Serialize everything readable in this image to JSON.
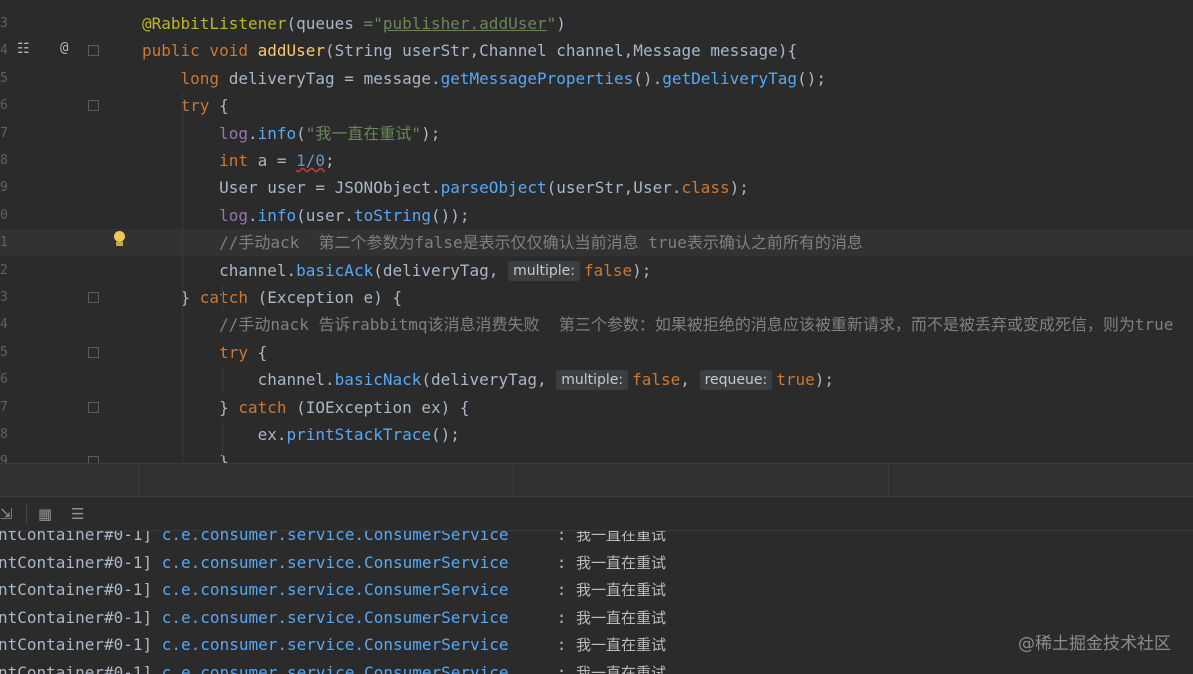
{
  "editor": {
    "line_numbers": [
      "3",
      "4",
      "5",
      "6",
      "7",
      "8",
      "9",
      "0",
      "1",
      "2",
      "3",
      "4",
      "5",
      "6",
      "7",
      "8",
      "9"
    ],
    "lines": [
      [
        {
          "t": "@RabbitListener",
          "c": "ann"
        },
        {
          "t": "(",
          "c": ""
        },
        {
          "t": "queues",
          "c": "param"
        },
        {
          "t": " =\"",
          "c": "str"
        },
        {
          "t": "publisher.addUser",
          "c": "str underline"
        },
        {
          "t": "\"",
          "c": "str"
        },
        {
          "t": ")",
          "c": ""
        }
      ],
      [
        {
          "t": "public void ",
          "c": "kw"
        },
        {
          "t": "addUser",
          "c": "fn"
        },
        {
          "t": "(String ",
          "c": ""
        },
        {
          "t": "userStr",
          "c": "param"
        },
        {
          "t": ",Channel ",
          "c": ""
        },
        {
          "t": "channel",
          "c": "param"
        },
        {
          "t": ",Message ",
          "c": ""
        },
        {
          "t": "message",
          "c": "param"
        },
        {
          "t": "){",
          "c": ""
        }
      ],
      [
        {
          "t": "    long ",
          "c": "kw"
        },
        {
          "t": "deliveryTag = ",
          "c": ""
        },
        {
          "t": "message",
          "c": "param"
        },
        {
          "t": ".",
          "c": ""
        },
        {
          "t": "getMessageProperties",
          "c": "m"
        },
        {
          "t": "().",
          "c": ""
        },
        {
          "t": "getDeliveryTag",
          "c": "m"
        },
        {
          "t": "();",
          "c": ""
        }
      ],
      [
        {
          "t": "    try ",
          "c": "kw"
        },
        {
          "t": "{",
          "c": ""
        }
      ],
      [
        {
          "t": "        log",
          "c": "fld"
        },
        {
          "t": ".",
          "c": ""
        },
        {
          "t": "info",
          "c": "m"
        },
        {
          "t": "(",
          "c": ""
        },
        {
          "t": "\"我一直在重试\"",
          "c": "str"
        },
        {
          "t": ");",
          "c": ""
        }
      ],
      [
        {
          "t": "        int ",
          "c": "kw"
        },
        {
          "t": "a = ",
          "c": ""
        },
        {
          "t": "1/0",
          "c": "num squiggle"
        },
        {
          "t": ";",
          "c": ""
        }
      ],
      [
        {
          "t": "        User user = ",
          "c": ""
        },
        {
          "t": "JSONObject",
          "c": ""
        },
        {
          "t": ".",
          "c": ""
        },
        {
          "t": "parseObject",
          "c": "m"
        },
        {
          "t": "(",
          "c": ""
        },
        {
          "t": "userStr",
          "c": "param"
        },
        {
          "t": ",User.",
          "c": ""
        },
        {
          "t": "class",
          "c": "kw"
        },
        {
          "t": ");",
          "c": ""
        }
      ],
      [
        {
          "t": "        log",
          "c": "fld"
        },
        {
          "t": ".",
          "c": ""
        },
        {
          "t": "info",
          "c": "m"
        },
        {
          "t": "(user.",
          "c": ""
        },
        {
          "t": "toString",
          "c": "m"
        },
        {
          "t": "());",
          "c": ""
        }
      ],
      [
        {
          "t": "        //手动ack  第二个参数为false是表示仅仅确认当前消息 true表示确认之前所有的消息",
          "c": "cmt"
        }
      ],
      [
        {
          "t": "        channel",
          "c": "param"
        },
        {
          "t": ".",
          "c": ""
        },
        {
          "t": "basicAck",
          "c": "m"
        },
        {
          "t": "(deliveryTag, ",
          "c": ""
        },
        {
          "t": "multiple:",
          "c": "hint"
        },
        {
          "t": "false",
          "c": "kw"
        },
        {
          "t": ");",
          "c": ""
        }
      ],
      [
        {
          "t": "    } ",
          "c": ""
        },
        {
          "t": "catch ",
          "c": "kw"
        },
        {
          "t": "(Exception e) {",
          "c": ""
        }
      ],
      [
        {
          "t": "        //手动nack 告诉rabbitmq该消息消费失败  第三个参数：如果被拒绝的消息应该被重新请求，而不是被丢弃或变成死信，则为true",
          "c": "cmt"
        }
      ],
      [
        {
          "t": "        try ",
          "c": "kw"
        },
        {
          "t": "{",
          "c": ""
        }
      ],
      [
        {
          "t": "            channel",
          "c": "param"
        },
        {
          "t": ".",
          "c": ""
        },
        {
          "t": "basicNack",
          "c": "m"
        },
        {
          "t": "(deliveryTag, ",
          "c": ""
        },
        {
          "t": "multiple:",
          "c": "hint"
        },
        {
          "t": "false",
          "c": "kw"
        },
        {
          "t": ", ",
          "c": ""
        },
        {
          "t": "requeue:",
          "c": "hint"
        },
        {
          "t": "true",
          "c": "kw"
        },
        {
          "t": ");",
          "c": ""
        }
      ],
      [
        {
          "t": "        } ",
          "c": ""
        },
        {
          "t": "catch ",
          "c": "kw"
        },
        {
          "t": "(IOException ",
          "c": ""
        },
        {
          "t": "ex",
          "c": "param"
        },
        {
          "t": ") {",
          "c": ""
        }
      ],
      [
        {
          "t": "            ex",
          "c": "param"
        },
        {
          "t": ".",
          "c": ""
        },
        {
          "t": "printStackTrace",
          "c": "m"
        },
        {
          "t": "();",
          "c": ""
        }
      ],
      [
        {
          "t": "        }",
          "c": ""
        }
      ]
    ],
    "gutter_icons": {
      "run_icon": "database-icon",
      "override_marker": "@"
    }
  },
  "console": {
    "lines": [
      {
        "thread": "ntContainer#0-1] ",
        "logger": "c.e.consumer.service.ConsumerService",
        "sep": "     : ",
        "msg": "我一直在重试"
      },
      {
        "thread": "ntContainer#0-1] ",
        "logger": "c.e.consumer.service.ConsumerService",
        "sep": "     : ",
        "msg": "我一直在重试"
      },
      {
        "thread": "ntContainer#0-1] ",
        "logger": "c.e.consumer.service.ConsumerService",
        "sep": "     : ",
        "msg": "我一直在重试"
      },
      {
        "thread": "ntContainer#0-1] ",
        "logger": "c.e.consumer.service.ConsumerService",
        "sep": "     : ",
        "msg": "我一直在重试"
      },
      {
        "thread": "ntContainer#0-1] ",
        "logger": "c.e.consumer.service.ConsumerService",
        "sep": "     : ",
        "msg": "我一直在重试"
      },
      {
        "thread": "ntContainer#0-1] ",
        "logger": "c.e.consumer.service.ConsumerService",
        "sep": "     : ",
        "msg": "我一直在重试"
      }
    ]
  },
  "watermark": "@稀土掘金技术社区",
  "colors": {
    "background": "#2b2b2b",
    "keyword": "#cc7832",
    "method": "#57a8f5",
    "string": "#6a8759",
    "comment": "#808080",
    "annotation": "#bbb529"
  }
}
